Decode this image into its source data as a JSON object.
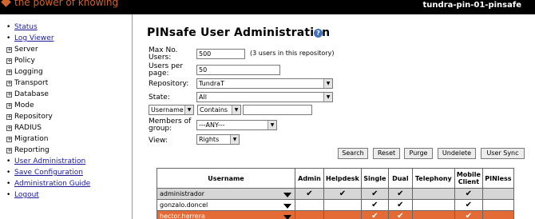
{
  "header": {
    "tagline": "the power of knowing",
    "hostname": "tundra-pin-01-pinsafe"
  },
  "sidebar": {
    "items": [
      {
        "label": "Status",
        "type": "link"
      },
      {
        "label": "Log Viewer",
        "type": "link"
      },
      {
        "label": "Server",
        "type": "group"
      },
      {
        "label": "Policy",
        "type": "group"
      },
      {
        "label": "Logging",
        "type": "group"
      },
      {
        "label": "Transport",
        "type": "group"
      },
      {
        "label": "Database",
        "type": "group"
      },
      {
        "label": "Mode",
        "type": "group"
      },
      {
        "label": "Repository",
        "type": "group"
      },
      {
        "label": "RADIUS",
        "type": "group"
      },
      {
        "label": "Migration",
        "type": "group"
      },
      {
        "label": "Reporting",
        "type": "group"
      },
      {
        "label": "User Administration",
        "type": "link"
      },
      {
        "label": "Save Configuration",
        "type": "link"
      },
      {
        "label": "Administration Guide",
        "type": "link"
      },
      {
        "label": "Logout",
        "type": "link"
      }
    ]
  },
  "main": {
    "title": "PINsafe User Administration",
    "help_icon": "?",
    "form": {
      "max_users_label_1": "Max No.",
      "max_users_label_2": "Users:",
      "max_users_value": "500",
      "users_count_note": "(3 users in this repository)",
      "users_per_page_label_1": "Users per",
      "users_per_page_label_2": "page:",
      "users_per_page_value": "50",
      "repository_label": "Repository:",
      "repository_value": "TundraT",
      "state_label": "State:",
      "state_value": "All",
      "filter_field_value": "Username",
      "filter_op_value": "Contains",
      "filter_text_value": "",
      "members_label_1": "Members of",
      "members_label_2": "group:",
      "members_value": "---ANY---",
      "view_label": "View:",
      "view_value": "Rights"
    },
    "buttons": {
      "search": "Search",
      "reset": "Reset",
      "purge": "Purge",
      "undelete": "Undelete",
      "user_sync": "User Sync"
    },
    "table": {
      "headers": {
        "username": "Username",
        "admin": "Admin",
        "helpdesk": "Helpdesk",
        "single": "Single",
        "dual": "Dual",
        "telephony": "Telephony",
        "mobile_1": "Mobile",
        "mobile_2": "Client",
        "pinless": "PINless"
      },
      "check_glyph": "✔",
      "rows": [
        {
          "username": "administrador",
          "admin": true,
          "helpdesk": true,
          "single": true,
          "dual": true,
          "telephony": false,
          "mobile": true,
          "pinless": false
        },
        {
          "username": "gonzalo.doncel",
          "admin": false,
          "helpdesk": false,
          "single": true,
          "dual": true,
          "telephony": false,
          "mobile": true,
          "pinless": false
        },
        {
          "username": "hector.herrera",
          "admin": false,
          "helpdesk": false,
          "single": true,
          "dual": true,
          "telephony": false,
          "mobile": true,
          "pinless": false
        }
      ]
    }
  },
  "colors": {
    "accent": "#d0662e",
    "link": "#1a1a9a",
    "selected_row": "#e46b35",
    "header_bg": "#000000"
  }
}
